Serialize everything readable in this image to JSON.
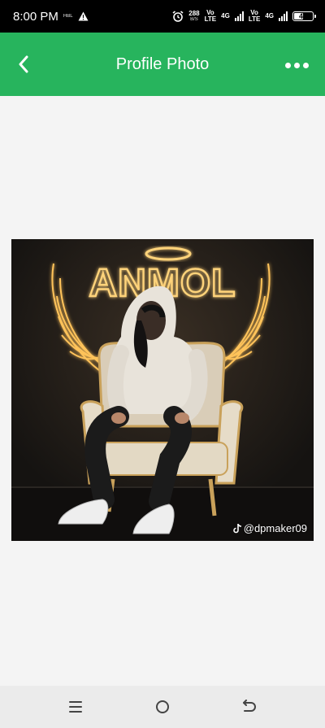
{
  "status_bar": {
    "time": "8:00 PM",
    "carrier_tag": "HBL",
    "data_speed_value": "288",
    "data_speed_unit": "B/S",
    "sim1_top": "Vo",
    "sim1_bottom": "LTE",
    "sim1_network": "4G",
    "sim2_top": "Vo",
    "sim2_bottom": "LTE",
    "sim2_network": "4G",
    "battery_level": "46",
    "icons": [
      "warning-icon",
      "alarm-icon",
      "signal-icon",
      "battery-icon"
    ]
  },
  "app_bar": {
    "title": "Profile Photo",
    "back_icon": "chevron-left-icon",
    "menu_icon": "more-horizontal-icon",
    "color": "#27b45d"
  },
  "photo": {
    "neon_text": "ANMOL",
    "watermark": "@dpmaker09",
    "watermark_icon": "tiktok-icon"
  },
  "nav_bar": {
    "icons": [
      "menu-icon",
      "home-icon",
      "back-icon"
    ]
  }
}
